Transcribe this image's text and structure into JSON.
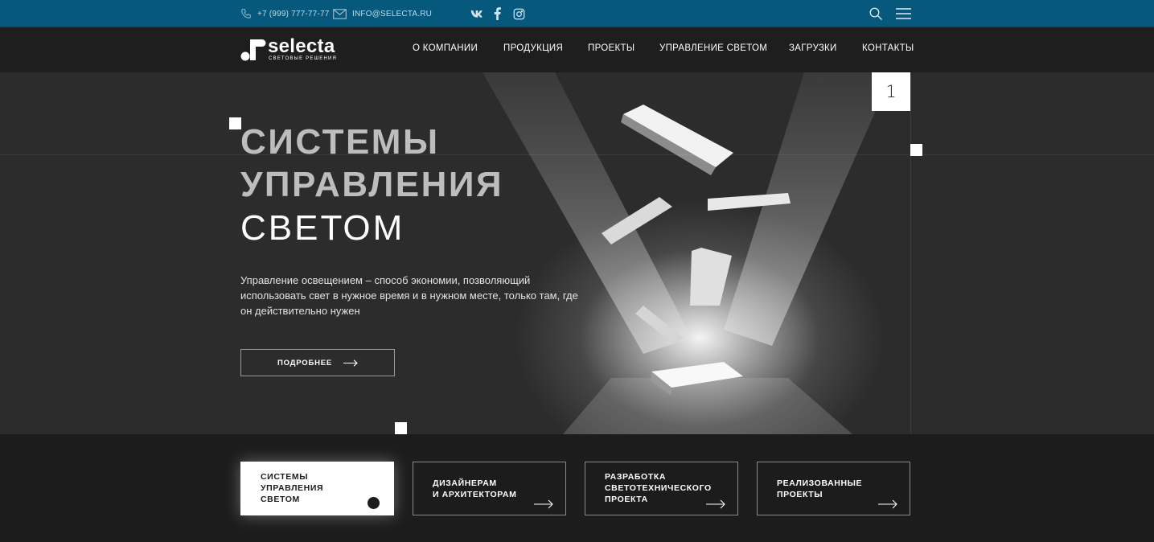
{
  "topbar": {
    "phone": "+7 (999) 777-77-77",
    "email": "INFO@SELECTA.RU",
    "social": [
      "vk-icon",
      "facebook-icon",
      "instagram-icon"
    ]
  },
  "header": {
    "logo_word": "selecta",
    "logo_sub": "СВЕТОВЫЕ РЕШЕНИЯ",
    "nav": [
      "О КОМПАНИИ",
      "ПРОДУКЦИЯ",
      "ПРОЕКТЫ",
      "УПРАВЛЕНИЕ СВЕТОМ",
      "ЗАГРУЗКИ",
      "КОНТАКТЫ"
    ]
  },
  "hero": {
    "slide_number": "1",
    "title_line1": "СИСТЕМЫ",
    "title_line2": "УПРАВЛЕНИЯ",
    "title_line3": "СВЕТОМ",
    "lead": "Управление освещением – способ экономии, позволяющий использовать свет в нужное время и в нужном месте, только там, где он действительно нужен",
    "button_label": "ПОДРОБНЕЕ"
  },
  "cards": [
    {
      "label": "СИСТЕМЫ\nУПРАВЛЕНИЯ\nСВЕТОМ",
      "active": true
    },
    {
      "label": "ДИЗАЙНЕРАМ\nИ АРХИТЕКТОРАМ",
      "active": false
    },
    {
      "label": "РАЗРАБОТКА\nСВЕТОТЕХНИЧЕСКОГО\nПРОЕКТА",
      "active": false
    },
    {
      "label": "РЕАЛИЗОВАННЫЕ\nПРОЕКТЫ",
      "active": false
    }
  ],
  "colors": {
    "topbar": "#06587c",
    "header": "#1e1e1e",
    "hero": "#2c2c2c",
    "accent_card": "#ffffff"
  }
}
